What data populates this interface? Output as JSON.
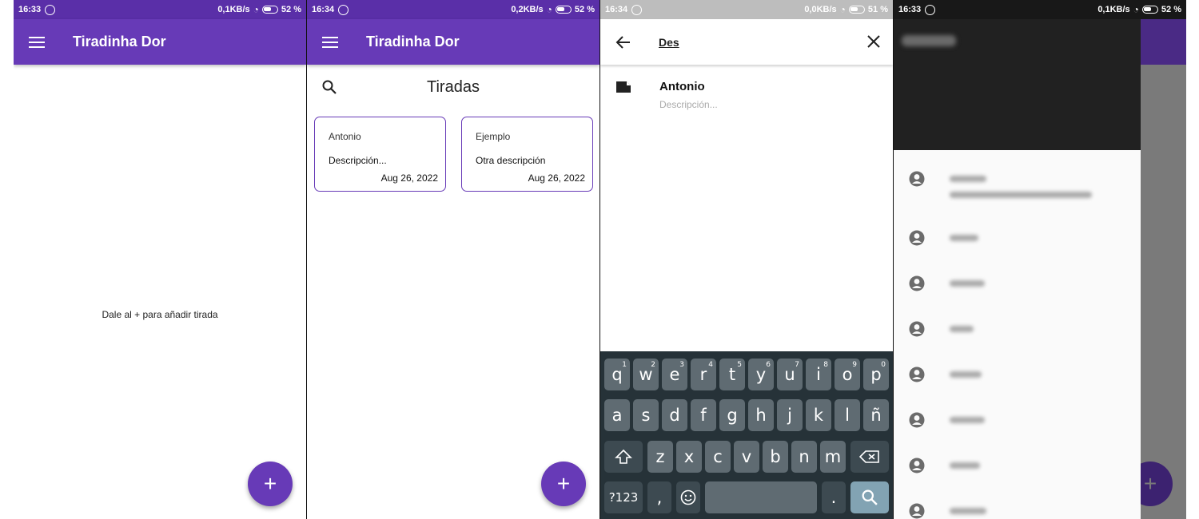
{
  "colors": {
    "primary": "#673ab7",
    "status_purple": "#5a2fa8",
    "keyboard": "#263238",
    "key": "#5f6b72",
    "drawer_header": "#212121"
  },
  "screens": [
    {
      "status": {
        "time": "16:33",
        "net": "0,1KB/s",
        "battery": "52 %"
      },
      "appbar": {
        "title": "Tiradinha Dor"
      },
      "empty_message": "Dale al + para añadir tirada",
      "fab": "+"
    },
    {
      "status": {
        "time": "16:34",
        "net": "0,2KB/s",
        "battery": "52 %"
      },
      "appbar": {
        "title": "Tiradinha Dor"
      },
      "header_title": "Tiradas",
      "cards": [
        {
          "name": "Antonio",
          "description": "Descripción...",
          "date": "Aug 26, 2022"
        },
        {
          "name": "Ejemplo",
          "description": "Otra descripción",
          "date": "Aug 26, 2022"
        }
      ],
      "fab": "+"
    },
    {
      "status": {
        "time": "16:34",
        "net": "0,0KB/s",
        "battery": "51 %"
      },
      "search": {
        "query": "Des"
      },
      "results": [
        {
          "name": "Antonio",
          "description": "Descripción..."
        }
      ],
      "keyboard": {
        "row1": [
          "q",
          "w",
          "e",
          "r",
          "t",
          "y",
          "u",
          "i",
          "o",
          "p"
        ],
        "row1_hints": [
          "1",
          "2",
          "3",
          "4",
          "5",
          "6",
          "7",
          "8",
          "9",
          "0"
        ],
        "row2": [
          "a",
          "s",
          "d",
          "f",
          "g",
          "h",
          "j",
          "k",
          "l",
          "ñ"
        ],
        "row3": [
          "z",
          "x",
          "c",
          "v",
          "b",
          "n",
          "m"
        ],
        "symbols_key": "?123",
        "comma_key": ",",
        "period_key": "."
      }
    },
    {
      "status": {
        "time": "16:33",
        "net": "0,1KB/s",
        "battery": "52 %"
      },
      "fab": "+"
    }
  ]
}
